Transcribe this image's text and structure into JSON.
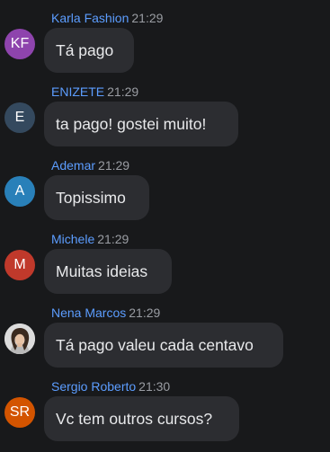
{
  "messages": [
    {
      "author": "Karla Fashion",
      "time": "21:29",
      "text": "Tá pago",
      "avatar": {
        "initials": "KF",
        "color": "#8e44ad"
      }
    },
    {
      "author": "ENIZETE",
      "time": "21:29",
      "text": "ta pago! gostei muito!",
      "avatar": {
        "initials": "E",
        "color": "#34495e"
      }
    },
    {
      "author": "Ademar",
      "time": "21:29",
      "text": "Topissimo",
      "avatar": {
        "initials": "A",
        "color": "#2980b9"
      }
    },
    {
      "author": "Michele",
      "time": "21:29",
      "text": "Muitas ideias",
      "avatar": {
        "initials": "M",
        "color": "#c0392b"
      }
    },
    {
      "author": "Nena Marcos",
      "time": "21:29",
      "text": "Tá pago valeu cada centavo",
      "avatar": {
        "initials": "",
        "color": "#d8d8d8",
        "icon": "user-photo-icon"
      }
    },
    {
      "author": "Sergio Roberto",
      "time": "21:30",
      "text": "Vc tem outros cursos?",
      "avatar": {
        "initials": "SR",
        "color": "#d35400"
      }
    }
  ]
}
